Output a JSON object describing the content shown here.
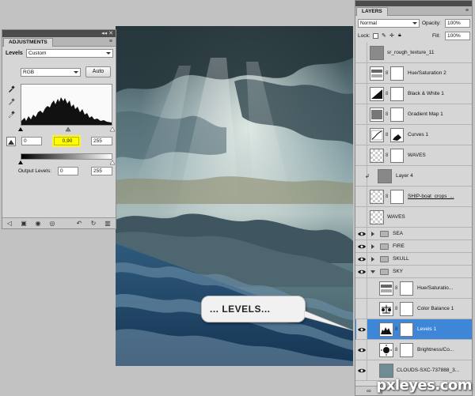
{
  "adjustments": {
    "tab_label": "ADJUSTMENTS",
    "panel_name": "Levels",
    "preset_value": "Custom",
    "channel_value": "RGB",
    "auto_label": "Auto",
    "input_black": "0",
    "input_gamma": "0,90",
    "input_white": "255",
    "output_label": "Output Levels:",
    "output_black": "0",
    "output_white": "255"
  },
  "callout": {
    "text": "... LEVELS..."
  },
  "layers": {
    "tab_label": "LAYERS",
    "blend_mode": "Normal",
    "opacity_label": "Opacity:",
    "opacity_value": "100%",
    "lock_label": "Lock:",
    "fill_label": "Fill:",
    "fill_value": "100%",
    "items": [
      {
        "name": "sr_rough_texture_11",
        "kind": "image",
        "visible": false
      },
      {
        "name": "Hue/Saturation 2",
        "kind": "adjustment",
        "icon": "hue-saturation-icon",
        "visible": false
      },
      {
        "name": "Black & White 1",
        "kind": "adjustment",
        "icon": "black-white-icon",
        "visible": false
      },
      {
        "name": "Gradient Map 1",
        "kind": "adjustment",
        "icon": "gradient-map-icon",
        "visible": false
      },
      {
        "name": "Curves 1",
        "kind": "adjustment",
        "icon": "curves-icon",
        "visible": false
      },
      {
        "name": "WAVES",
        "kind": "masked",
        "visible": false
      },
      {
        "name": "Layer 4",
        "kind": "clipped",
        "visible": false
      },
      {
        "name": "SHIP-boat_crops_...",
        "kind": "masked",
        "visible": false
      },
      {
        "name": "WAVES",
        "kind": "image",
        "visible": false
      },
      {
        "name": "SEA",
        "kind": "group",
        "visible": true,
        "expanded": false
      },
      {
        "name": "FIRE",
        "kind": "group",
        "visible": true,
        "expanded": false
      },
      {
        "name": "SKULL",
        "kind": "group",
        "visible": true,
        "expanded": false
      },
      {
        "name": "SKY",
        "kind": "group",
        "visible": true,
        "expanded": true
      },
      {
        "name": "Hue/Saturatio...",
        "kind": "adjustment",
        "icon": "hue-saturation-icon",
        "visible": false
      },
      {
        "name": "Color Balance 1",
        "kind": "adjustment",
        "icon": "color-balance-icon",
        "visible": false
      },
      {
        "name": "Levels 1",
        "kind": "adjustment",
        "icon": "levels-icon",
        "visible": true,
        "selected": true
      },
      {
        "name": "Brightness/Co...",
        "kind": "adjustment",
        "icon": "brightness-contrast-icon",
        "visible": true
      },
      {
        "name": "CLOUDS-SXC-737888_3...",
        "kind": "image",
        "visible": true
      }
    ]
  },
  "watermark": {
    "text": "pxleyes.com"
  },
  "colors": {
    "selection": "#3d86d8",
    "highlight": "#ffff00",
    "panel_bg": "#d6d6d6",
    "title_bar": "#4b4b4b"
  }
}
